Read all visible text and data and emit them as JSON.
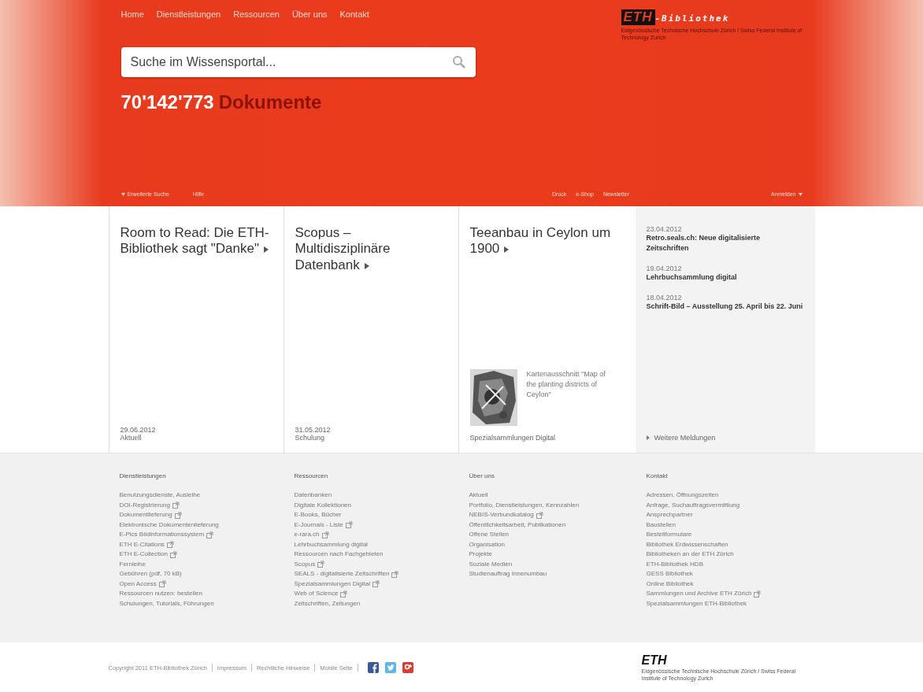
{
  "nav": [
    "Home",
    "Dienstleistungen",
    "Ressourcen",
    "Über uns",
    "Kontakt"
  ],
  "logo": {
    "mark": "ETH",
    "name": "-Bibliothek",
    "subtitle": "Eidgenössische Technische Hochschule Zürich / Swiss Federal Institute of Technology Zurich"
  },
  "search": {
    "placeholder": "Suche im Wissensportal..."
  },
  "count": {
    "number": "70'142'773",
    "label": "Dokumente"
  },
  "subbar": {
    "left": [
      "Erweiterte Suche",
      "Hilfe"
    ],
    "middle": [
      "Druck",
      "e-Shop",
      "Newsletter"
    ],
    "right": "Anmelden"
  },
  "cards": [
    {
      "title": "Room to Read: Die ETH-Bibliothek sagt \"Danke\"",
      "date": "29.06.2012",
      "category": "Aktuell"
    },
    {
      "title": "Scopus – Multidisziplinäre Datenbank",
      "date": "31.05.2012",
      "category": "Schulung"
    },
    {
      "title": "Teeanbau in Ceylon um 1900",
      "caption": "Kartenausschnitt \"Map of the planting districts of Ceylon\"",
      "category": "Spezialsammlungen Digital",
      "kind": "picture"
    }
  ],
  "news": {
    "items": [
      {
        "date": "23.04.2012",
        "title": "Retro.seals.ch: Neue digitalisierte Zeitschriften"
      },
      {
        "date": "19.04.2012",
        "title": "Lehrbuchsammlung digital"
      },
      {
        "date": "18.04.2012",
        "title": "Schrift-Bild – Ausstellung 25. April bis 22. Juni"
      }
    ],
    "more": "Weitere Meldungen"
  },
  "footer_columns": [
    {
      "heading": "Dienstleistungen",
      "links": [
        {
          "label": "Benutzungsdienste, Ausleihe",
          "external": false
        },
        {
          "label": "DOI-Registrierung",
          "external": true
        },
        {
          "label": "Dokumentlieferung",
          "external": true
        },
        {
          "label": "Elektronische Dokumentenlieferung",
          "external": false
        },
        {
          "label": "E-Pics Bildinformationssystem",
          "external": true
        },
        {
          "label": "ETH E-Citations",
          "external": true
        },
        {
          "label": "ETH E-Collection",
          "external": true
        },
        {
          "label": "Fernleihe",
          "external": false
        },
        {
          "label": "Gebühren (pdf, 70 kB)",
          "external": false
        },
        {
          "label": "Open Access",
          "external": true
        },
        {
          "label": "Ressourcen nutzen: bestellen",
          "external": false
        },
        {
          "label": "Schulungen, Tutorials, Führungen",
          "external": false
        }
      ]
    },
    {
      "heading": "Ressourcen",
      "links": [
        {
          "label": "Datenbanken",
          "external": false
        },
        {
          "label": "Digitale Kollektionen",
          "external": false
        },
        {
          "label": "E-Books, Bücher",
          "external": false
        },
        {
          "label": "E-Journals - Liste",
          "external": true
        },
        {
          "label": "e-rara.ch",
          "external": true
        },
        {
          "label": "Lehrbuchsammlung digital",
          "external": false
        },
        {
          "label": "Ressourcen nach Fachgebieten",
          "external": false
        },
        {
          "label": "Scopus",
          "external": true
        },
        {
          "label": "SEALS - digitalisierte Zeitschriften",
          "external": true
        },
        {
          "label": "Spezialsammlungen Digital",
          "external": true
        },
        {
          "label": "Web of Science",
          "external": true
        },
        {
          "label": "Zeitschriften, Zeitungen",
          "external": false
        }
      ]
    },
    {
      "heading": "Über uns",
      "links": [
        {
          "label": "Aktuell",
          "external": false
        },
        {
          "label": "Portfolio, Dienstleistungen, Kennzahlen",
          "external": false
        },
        {
          "label": "NEBIS-Verbundkatalog",
          "external": true
        },
        {
          "label": "Öffentlichkeitsarbeit, Publikationen",
          "external": false
        },
        {
          "label": "Offene Stellen",
          "external": false
        },
        {
          "label": "Organisation",
          "external": false
        },
        {
          "label": "Projekte",
          "external": false
        },
        {
          "label": "Soziale Medien",
          "external": false
        },
        {
          "label": "Studienauftrag Innenumbau",
          "external": false
        }
      ]
    },
    {
      "heading": "Kontakt",
      "links": [
        {
          "label": "Adressen, Öffnungszeiten",
          "external": false
        },
        {
          "label": "Anfrage, Suchauftragsvermittlung",
          "external": false
        },
        {
          "label": "Ansprechpartner",
          "external": false
        },
        {
          "label": "Baustellen",
          "external": false
        },
        {
          "label": "Bestellformulare",
          "external": false
        },
        {
          "label": "Bibliothek Erdwissenschaften",
          "external": false
        },
        {
          "label": "Bibliotheken an der ETH Zürich",
          "external": false
        },
        {
          "label": "ETH-Bibliothek HDB",
          "external": false
        },
        {
          "label": "GESS Bibliothek",
          "external": false
        },
        {
          "label": "Online Bibliothek",
          "external": false
        },
        {
          "label": "Sammlungen und Archive ETH Zürich",
          "external": true
        },
        {
          "label": "Spezialsammlungen ETH-Bibliothek",
          "external": false
        }
      ]
    }
  ],
  "bottom": {
    "links": [
      "Copyright 2011 ETH-Bibliothek Zürich",
      "Impressum",
      "Rechtliche Hinweise",
      "Mobile Seite"
    ],
    "social": [
      {
        "kind": "facebook"
      },
      {
        "kind": "twitter"
      },
      {
        "kind": "googleplus"
      }
    ],
    "logo": {
      "mark": "ETH",
      "subtitle": "Eidgenössische Technische Hochschule Zürich / Swiss Federal Institute of Technology Zurich"
    }
  }
}
